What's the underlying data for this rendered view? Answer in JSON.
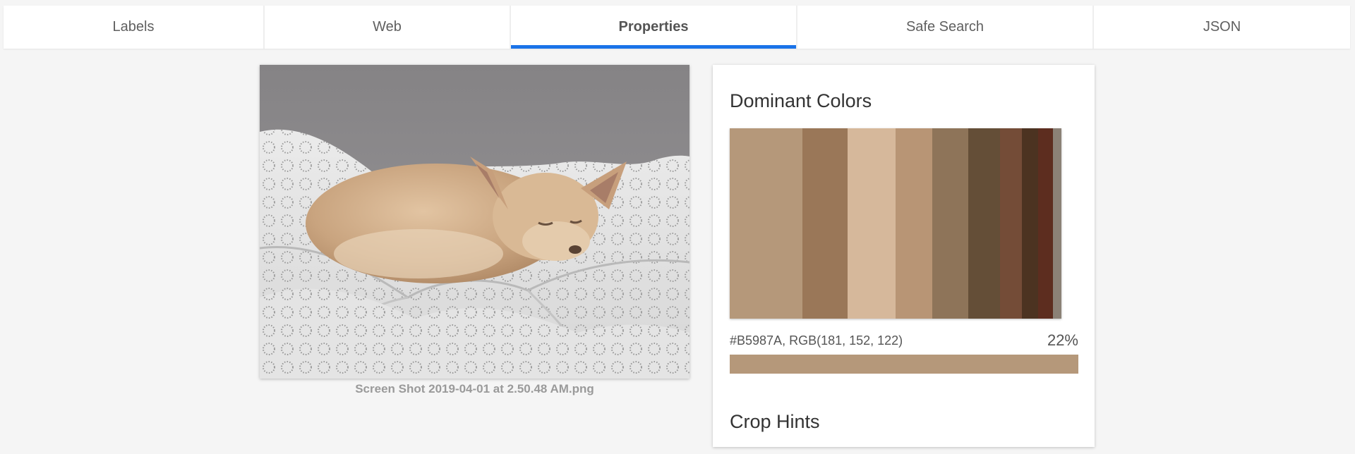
{
  "tabs": [
    {
      "label": "Labels",
      "active": false
    },
    {
      "label": "Web",
      "active": false
    },
    {
      "label": "Properties",
      "active": true
    },
    {
      "label": "Safe Search",
      "active": false
    },
    {
      "label": "JSON",
      "active": false
    }
  ],
  "accent_color": "#1a73e8",
  "image": {
    "caption": "Screen Shot 2019-04-01 at 2.50.48 AM.png",
    "subject": "dog-on-bed-photo"
  },
  "properties": {
    "dominant_colors_title": "Dominant Colors",
    "crop_hints_title": "Crop Hints",
    "colors": [
      {
        "hex": "#B5987A",
        "fraction": 0.22
      },
      {
        "hex": "#9A7758",
        "fraction": 0.135
      },
      {
        "hex": "#D6B89B",
        "fraction": 0.145
      },
      {
        "hex": "#B89575",
        "fraction": 0.11
      },
      {
        "hex": "#8E7459",
        "fraction": 0.11
      },
      {
        "hex": "#644E37",
        "fraction": 0.095
      },
      {
        "hex": "#744C37",
        "fraction": 0.065
      },
      {
        "hex": "#4C3321",
        "fraction": 0.05
      },
      {
        "hex": "#5D2D1F",
        "fraction": 0.045
      },
      {
        "hex": "#8B8176",
        "fraction": 0.025
      }
    ],
    "selected": {
      "code_text": "#B5987A,  RGB(181, 152, 122)",
      "percent_text": "22%",
      "hex": "#B5987A",
      "fraction": 0.22
    }
  }
}
